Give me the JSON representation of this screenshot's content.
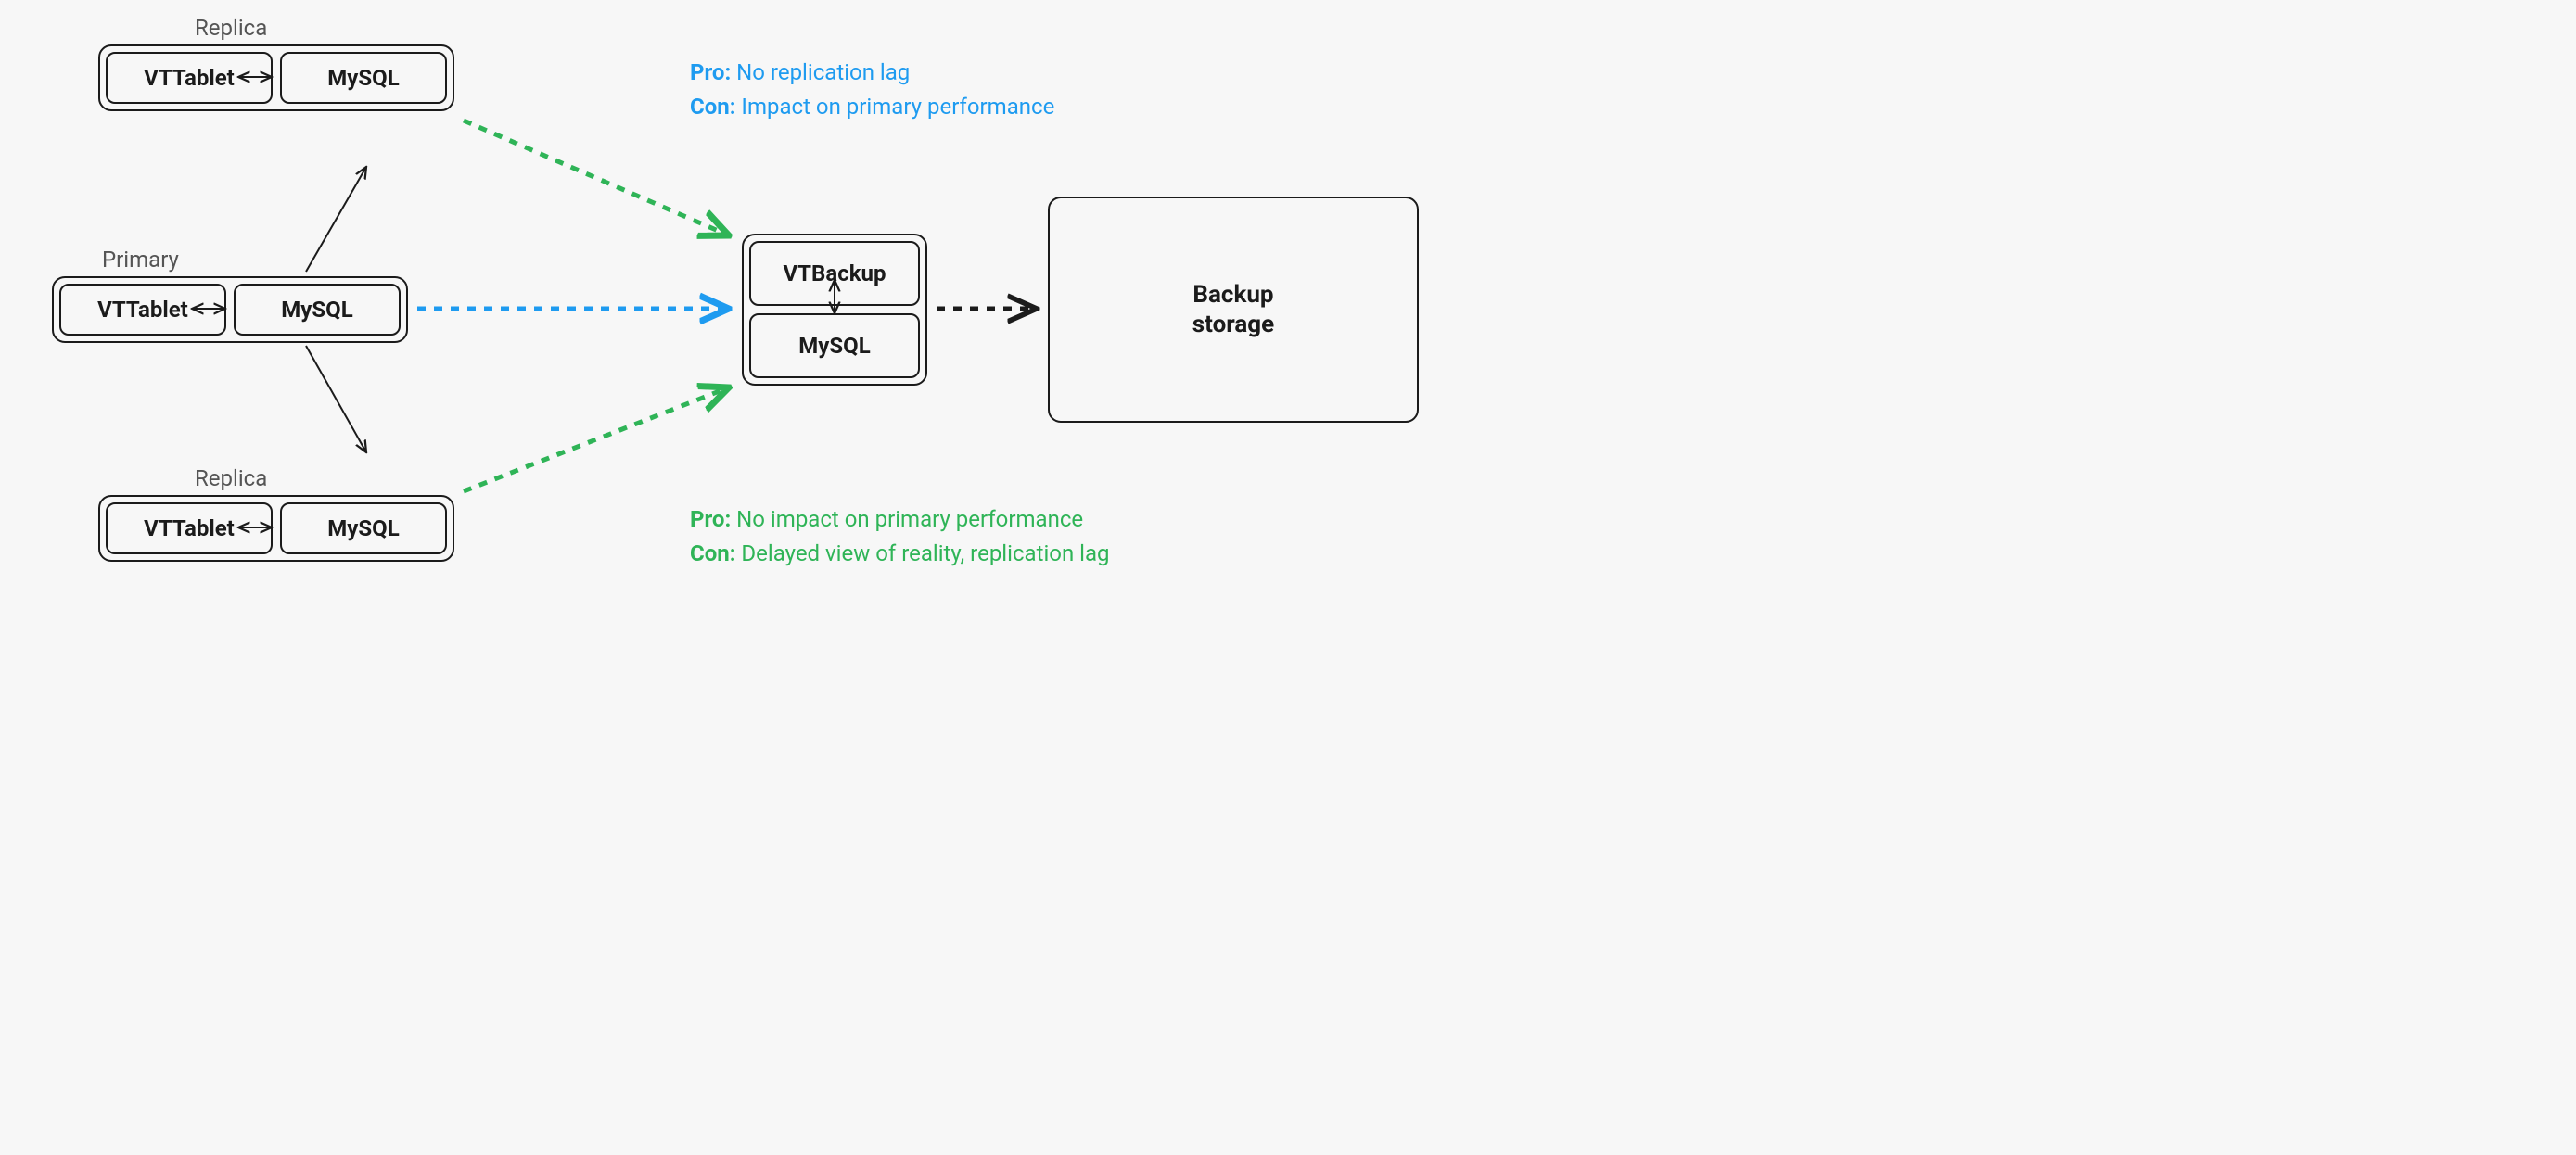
{
  "nodes": {
    "replica1": {
      "label": "Replica",
      "vttablet": "VTTablet",
      "mysql": "MySQL"
    },
    "primary": {
      "label": "Primary",
      "vttablet": "VTTablet",
      "mysql": "MySQL"
    },
    "replica2": {
      "label": "Replica",
      "vttablet": "VTTablet",
      "mysql": "MySQL"
    },
    "backup_node": {
      "vtbackup": "VTBackup",
      "mysql": "MySQL"
    },
    "storage": {
      "label_line1": "Backup",
      "label_line2": "storage"
    }
  },
  "annotations": {
    "blue": {
      "pro_label": "Pro:",
      "pro_text": "No replication lag",
      "con_label": "Con:",
      "con_text": "Impact on primary performance"
    },
    "green": {
      "pro_label": "Pro:",
      "pro_text": "No impact on primary performance",
      "con_label": "Con:",
      "con_text": "Delayed view of reality, replication lag"
    }
  },
  "colors": {
    "blue": "#1e9bf0",
    "green": "#2fb457",
    "black": "#1b1b1b"
  }
}
